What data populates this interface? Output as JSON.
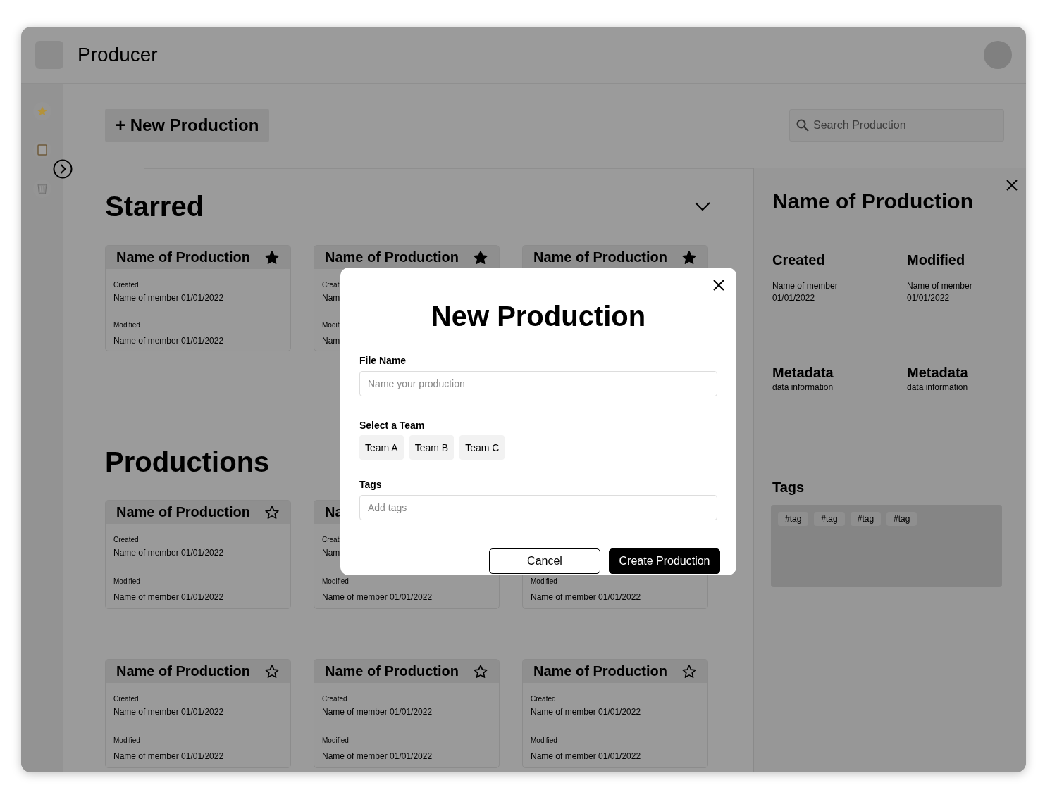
{
  "app": {
    "title": "Producer"
  },
  "toolbar": {
    "new_button": "+ New Production",
    "search": {
      "placeholder": "Search Production"
    }
  },
  "sections": [
    {
      "title": "Starred",
      "expanded": true,
      "cards": [
        {
          "title": "Name of Production",
          "starred": true,
          "created_label": "Created",
          "created": "Name of member 01/01/2022",
          "modified_label": "Modified",
          "modified": "Name of member 01/01/2022"
        },
        {
          "title": "Name of Production",
          "starred": true,
          "created_label": "Creat",
          "created": "Nam",
          "modified_label": "Modif",
          "modified": "Nam"
        },
        {
          "title": "Name of Production",
          "starred": true
        }
      ]
    },
    {
      "title": "Productions",
      "cards": [
        {
          "title": "Name of Production",
          "starred": false,
          "created_label": "Created",
          "created": "Name of member 01/01/2022",
          "modified_label": "Modified",
          "modified": "Name of member 01/01/2022"
        },
        {
          "title": "Na",
          "created_label": "Creat",
          "created": "Nam",
          "modified_label": "Modified",
          "modified": "Name of member 01/01/2022"
        },
        {
          "modified_label": "Modified",
          "modified": "Name of member 01/01/2022"
        },
        {
          "title": "Name of Production",
          "starred": false,
          "created_label": "Created",
          "created": "Name of member 01/01/2022",
          "modified_label": "Modified",
          "modified": "Name of member 01/01/2022"
        },
        {
          "title": "Name of Production",
          "starred": false,
          "created_label": "Created",
          "created": "Name of member 01/01/2022",
          "modified_label": "Modified",
          "modified": "Name of member 01/01/2022"
        },
        {
          "title": "Name of Production",
          "starred": false,
          "created_label": "Created",
          "created": "Name of member 01/01/2022",
          "modified_label": "Modified",
          "modified": "Name of member 01/01/2022"
        }
      ]
    }
  ],
  "detail": {
    "title": "Name of Production",
    "dates": [
      {
        "label": "Created",
        "member": "Name of member",
        "date": "01/01/2022"
      },
      {
        "label": "Modified",
        "member": "Name of member",
        "date": "01/01/2022"
      }
    ],
    "metadata": [
      {
        "label": "Metadata",
        "value": "data information"
      },
      {
        "label": "Metadata",
        "value": "data information"
      }
    ],
    "tags_label": "Tags",
    "tags": [
      "#tag",
      "#tag",
      "#tag",
      "#tag"
    ]
  },
  "modal": {
    "title": "New Production",
    "file_name": {
      "label": "File Name",
      "placeholder": "Name your production"
    },
    "team_label": "Select a Team",
    "teams": [
      {
        "label": "Team A",
        "selected": false
      },
      {
        "label": "Team B",
        "selected": false
      },
      {
        "label": "Team C",
        "selected": false
      }
    ],
    "tags": {
      "label": "Tags",
      "placeholder": "Add tags"
    },
    "buttons": {
      "cancel": "Cancel",
      "create": "Create Production"
    }
  }
}
